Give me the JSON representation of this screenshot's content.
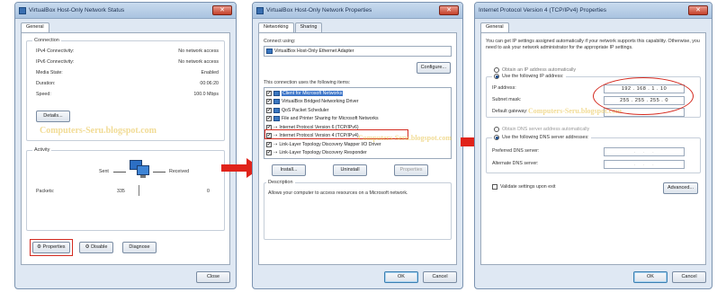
{
  "win1": {
    "title": "VirtualBox Host-Only Network Status",
    "tab": "General",
    "connection_title": "Connection",
    "rows": [
      {
        "label": "IPv4 Connectivity:",
        "value": "No network access"
      },
      {
        "label": "IPv6 Connectivity:",
        "value": "No network access"
      },
      {
        "label": "Media State:",
        "value": "Enabled"
      },
      {
        "label": "Duration:",
        "value": "00:06:20"
      },
      {
        "label": "Speed:",
        "value": "100.0 Mbps"
      }
    ],
    "details_btn": "Details...",
    "watermark": "Computers-Seru.blogspot.com",
    "activity_title": "Activity",
    "sent_label": "Sent",
    "received_label": "Received",
    "packets_label": "Packets:",
    "packets_sent": "335",
    "packets_received": "0",
    "properties_btn": "Properties",
    "disable_btn": "Disable",
    "diagnose_btn": "Diagnose",
    "close_btn": "Close"
  },
  "win2": {
    "title": "VirtualBox Host-Only Network Properties",
    "tabs": [
      "Networking",
      "Sharing"
    ],
    "connect_using": "Connect using:",
    "adapter": "VirtualBox Host-Only Ethernet Adapter",
    "configure_btn": "Configure...",
    "uses_label": "This connection uses the following items:",
    "items": [
      "Client for Microsoft Networks",
      "VirtualBox Bridged Networking Driver",
      "QoS Packet Scheduler",
      "File and Printer Sharing for Microsoft Networks",
      "Internet Protocol Version 6 (TCP/IPv6)",
      "Internet Protocol Version 4 (TCP/IPv4)",
      "Link-Layer Topology Discovery Mapper I/O Driver",
      "Link-Layer Topology Discovery Responder"
    ],
    "install_btn": "Install...",
    "uninstall_btn": "Uninstall",
    "properties_btn": "Properties",
    "description_title": "Description",
    "description": "Allows your computer to access resources on a Microsoft network.",
    "ok_btn": "OK",
    "cancel_btn": "Cancel",
    "watermark": "Computers-Seru.blogspot.com"
  },
  "win3": {
    "title": "Internet Protocol Version 4 (TCP/IPv4) Properties",
    "tab": "General",
    "intro": "You can get IP settings assigned automatically if your network supports this capability. Otherwise, you need to ask your network administrator for the appropriate IP settings.",
    "auto_ip": "Obtain an IP address automatically",
    "use_ip": "Use the following IP address:",
    "ip_label": "IP address:",
    "ip_value": "192 . 168 . 1 . 10",
    "mask_label": "Subnet mask:",
    "mask_value": "255 . 255 . 255 . 0",
    "gateway_label": "Default gateway:",
    "auto_dns": "Obtain DNS server address automatically",
    "use_dns": "Use the following DNS server addresses:",
    "pref_dns": "Preferred DNS server:",
    "alt_dns": "Alternate DNS server:",
    "validate": "Validate settings upon exit",
    "advanced_btn": "Advanced...",
    "ok_btn": "OK",
    "cancel_btn": "Cancel",
    "watermark": "Computers-Seru.blogspot.com"
  }
}
